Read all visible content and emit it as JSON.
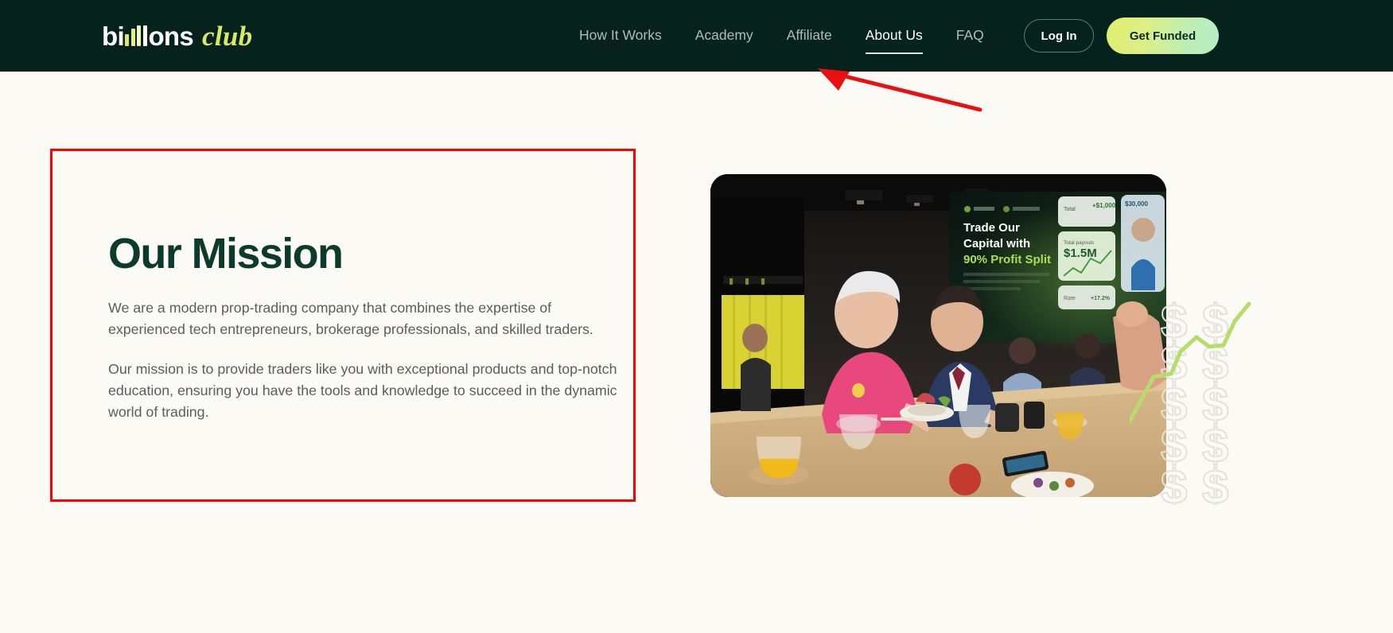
{
  "site": {
    "logo": {
      "word_primary": "bi",
      "word_primary_tail": "ons",
      "word_secondary": "club",
      "bar_colors": [
        "#D9E86B",
        "#E4EE8A",
        "#F2F6C0",
        "#FFFFFF"
      ],
      "primary_color": "#FFFFFF",
      "secondary_color": "#D8E96A"
    },
    "header_bg": "#05231C",
    "page_bg": "#FBFAF5",
    "accent_green": "#0C3B2E",
    "annotation_color": "#FF0000"
  },
  "nav": {
    "items": [
      {
        "label": "How It Works",
        "active": false
      },
      {
        "label": "Academy",
        "active": false
      },
      {
        "label": "Affiliate",
        "active": false
      },
      {
        "label": "About Us",
        "active": true
      },
      {
        "label": "FAQ",
        "active": false
      }
    ],
    "login_label": "Log In",
    "cta_label": "Get Funded"
  },
  "mission": {
    "title": "Our Mission",
    "paragraph_1": "We are a modern prop-trading company that combines the expertise of experienced tech entrepreneurs, brokerage professionals, and skilled traders.",
    "paragraph_2": "Our mission is to provide traders like you with exceptional products and top-notch education, ensuring you have the tools and knowledge to succeed in the dynamic world of trading."
  },
  "photo": {
    "description": "People seated at a long wooden table in a dark event venue, smiling and talking, with drinks and plates of food on the table",
    "screen_headline_line_1": "Trade Our",
    "screen_headline_line_2": "Capital with",
    "screen_headline_line_3": "90% Profit Split",
    "screen_stat_value": "$1.5M",
    "screen_stat_secondary": "$30,000"
  },
  "decor": {
    "dollar_glyph": "$",
    "dollar_rows": 5,
    "dollar_cols": 2,
    "dollar_stroke": "#E3E1DA",
    "trendline_color": "#B8DC6B"
  },
  "annotations": {
    "arrow_label": "pointer-to-about-us",
    "highlight_label": "highlight-our-mission-section"
  }
}
